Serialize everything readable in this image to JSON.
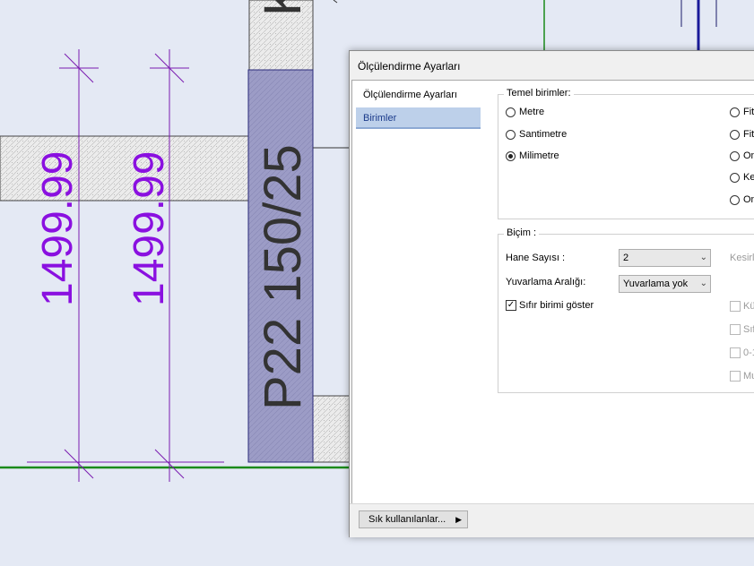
{
  "cad": {
    "dimension_left": "1499.99",
    "dimension_right": "1499.99",
    "column_label": "P22 150/25",
    "top_label_partial": "K"
  },
  "dialog": {
    "title": "Ölçülendirme Ayarları",
    "nav_items": [
      {
        "label": "Ölçülendirme Ayarları",
        "selected": false
      },
      {
        "label": "Birimler",
        "selected": true
      }
    ],
    "base_units": {
      "title": "Temel birimler:",
      "options_left": [
        {
          "label": "Metre",
          "checked": false
        },
        {
          "label": "Santimetre",
          "checked": false
        },
        {
          "label": "Milimetre",
          "checked": true
        }
      ],
      "options_right": [
        {
          "label": "Fit",
          "checked": false
        },
        {
          "label": "Fit",
          "checked": false
        },
        {
          "label": "On",
          "checked": false
        },
        {
          "label": "Ke",
          "checked": false
        },
        {
          "label": "On",
          "checked": false
        }
      ]
    },
    "format": {
      "title": "Biçim :",
      "decimals_label": "Hane Sayısı :",
      "decimals_value": "2",
      "rounding_label": "Yuvarlama Aralığı:",
      "rounding_value": "Yuvarlama yok",
      "fraction_label": "Kesirl",
      "show_zero_label": "Sıfır birimi göster",
      "show_zero_checked": true,
      "right_checks": [
        "Kü",
        "Sıf",
        "0-1",
        "Mu"
      ]
    },
    "frequent_button": "Sık kullanılanlar..."
  }
}
